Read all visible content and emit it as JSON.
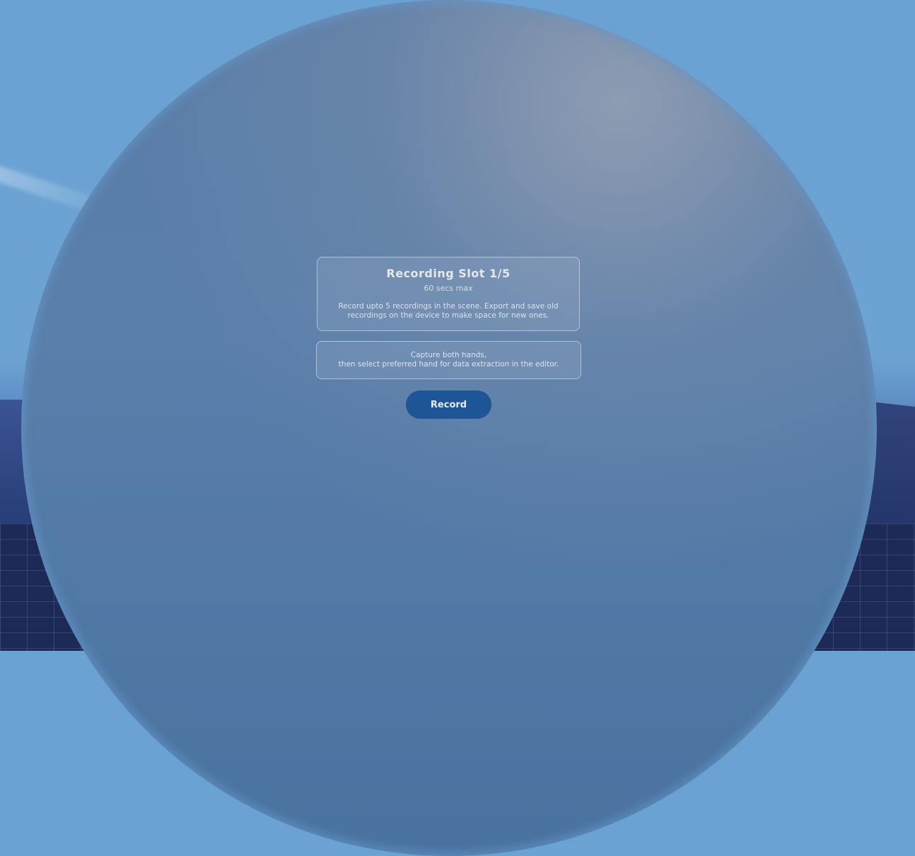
{
  "recording_panel": {
    "title": "Recording Slot 1/5",
    "subtitle": "60 secs max",
    "description_line1": "Record upto 5 recordings in the scene. Export and save old",
    "description_line2": "recordings on the device to make space for new ones."
  },
  "hint_panel": {
    "line1": "Capture both hands,",
    "line2": "then select preferred hand for data extraction in the editor."
  },
  "record_button": {
    "label": "Record",
    "color": "#1d5596"
  }
}
